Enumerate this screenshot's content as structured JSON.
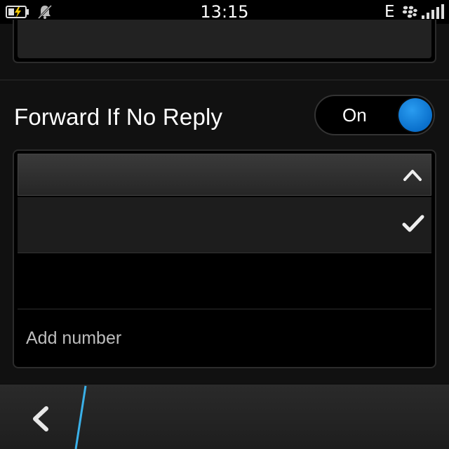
{
  "status_bar": {
    "time": "13:15",
    "network": "E",
    "icons": [
      "battery-charging-icon",
      "bell-muted-icon",
      "blackberry-icon",
      "signal-icon"
    ]
  },
  "forward_section": {
    "title": "Forward If No Reply",
    "toggle_label": "On",
    "toggle_on": true,
    "add_number_label": "Add number"
  },
  "colors": {
    "accent_blue": "#0a78d4",
    "accent_line": "#3ab0e8"
  }
}
